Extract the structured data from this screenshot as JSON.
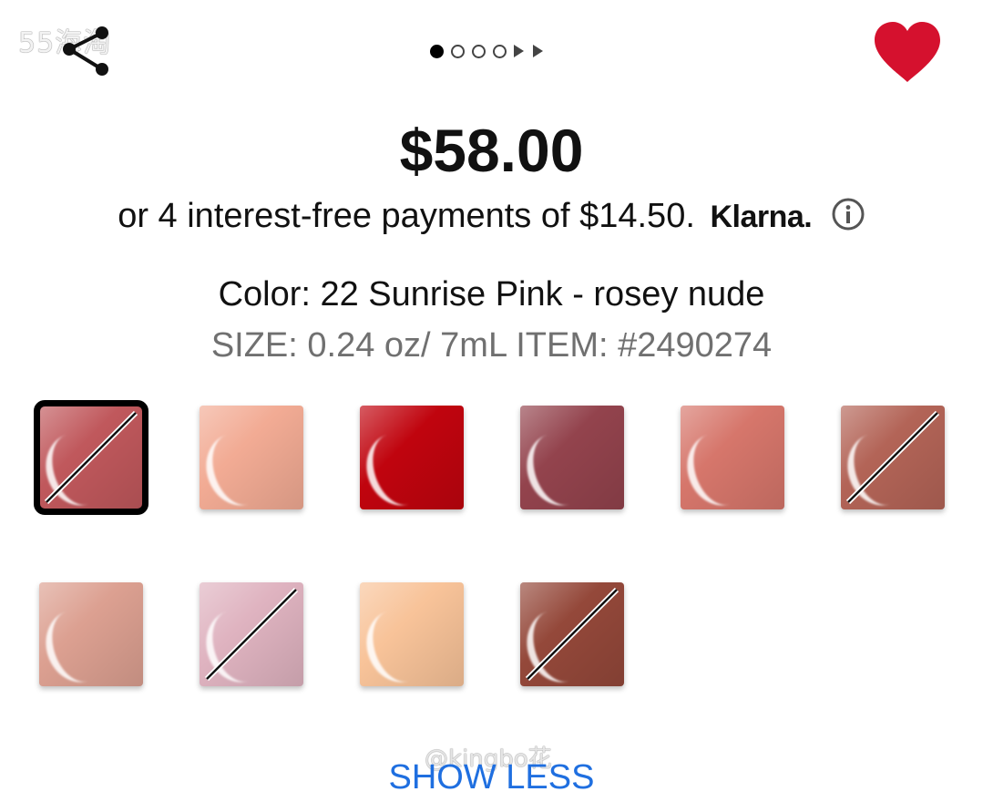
{
  "watermarks": {
    "top": "55海淘",
    "bottom": "@kingbo花"
  },
  "header": {
    "share_icon": "share-icon",
    "favorite_icon": "heart-icon",
    "favorite_color": "#d5112e",
    "pager": {
      "dots": 4,
      "active_index": 0,
      "arrows": 2
    }
  },
  "product": {
    "price": "$58.00",
    "installments_text": "or 4 interest-free payments of $14.50.",
    "klarna_label": "Klarna.",
    "info_icon": "info-icon",
    "color_line": "Color: 22 Sunrise Pink - rosey nude",
    "size_line": "SIZE: 0.24 oz/ 7mL ITEM: #2490274"
  },
  "swatches": [
    {
      "color": "#c0585c",
      "selected": true,
      "unavailable": true
    },
    {
      "color": "#f2ab94",
      "selected": false,
      "unavailable": false
    },
    {
      "color": "#c0040e",
      "selected": false,
      "unavailable": false
    },
    {
      "color": "#93434d",
      "selected": false,
      "unavailable": false
    },
    {
      "color": "#d6766b",
      "selected": false,
      "unavailable": false
    },
    {
      "color": "#b36457",
      "selected": false,
      "unavailable": true
    },
    {
      "color": "#dca091",
      "selected": false,
      "unavailable": false
    },
    {
      "color": "#dfb3c0",
      "selected": false,
      "unavailable": true
    },
    {
      "color": "#f8c399",
      "selected": false,
      "unavailable": false
    },
    {
      "color": "#94483a",
      "selected": false,
      "unavailable": true
    }
  ],
  "actions": {
    "show_less_label": "SHOW LESS"
  },
  "colors": {
    "link": "#1f6fe0",
    "muted_text": "#707070"
  }
}
